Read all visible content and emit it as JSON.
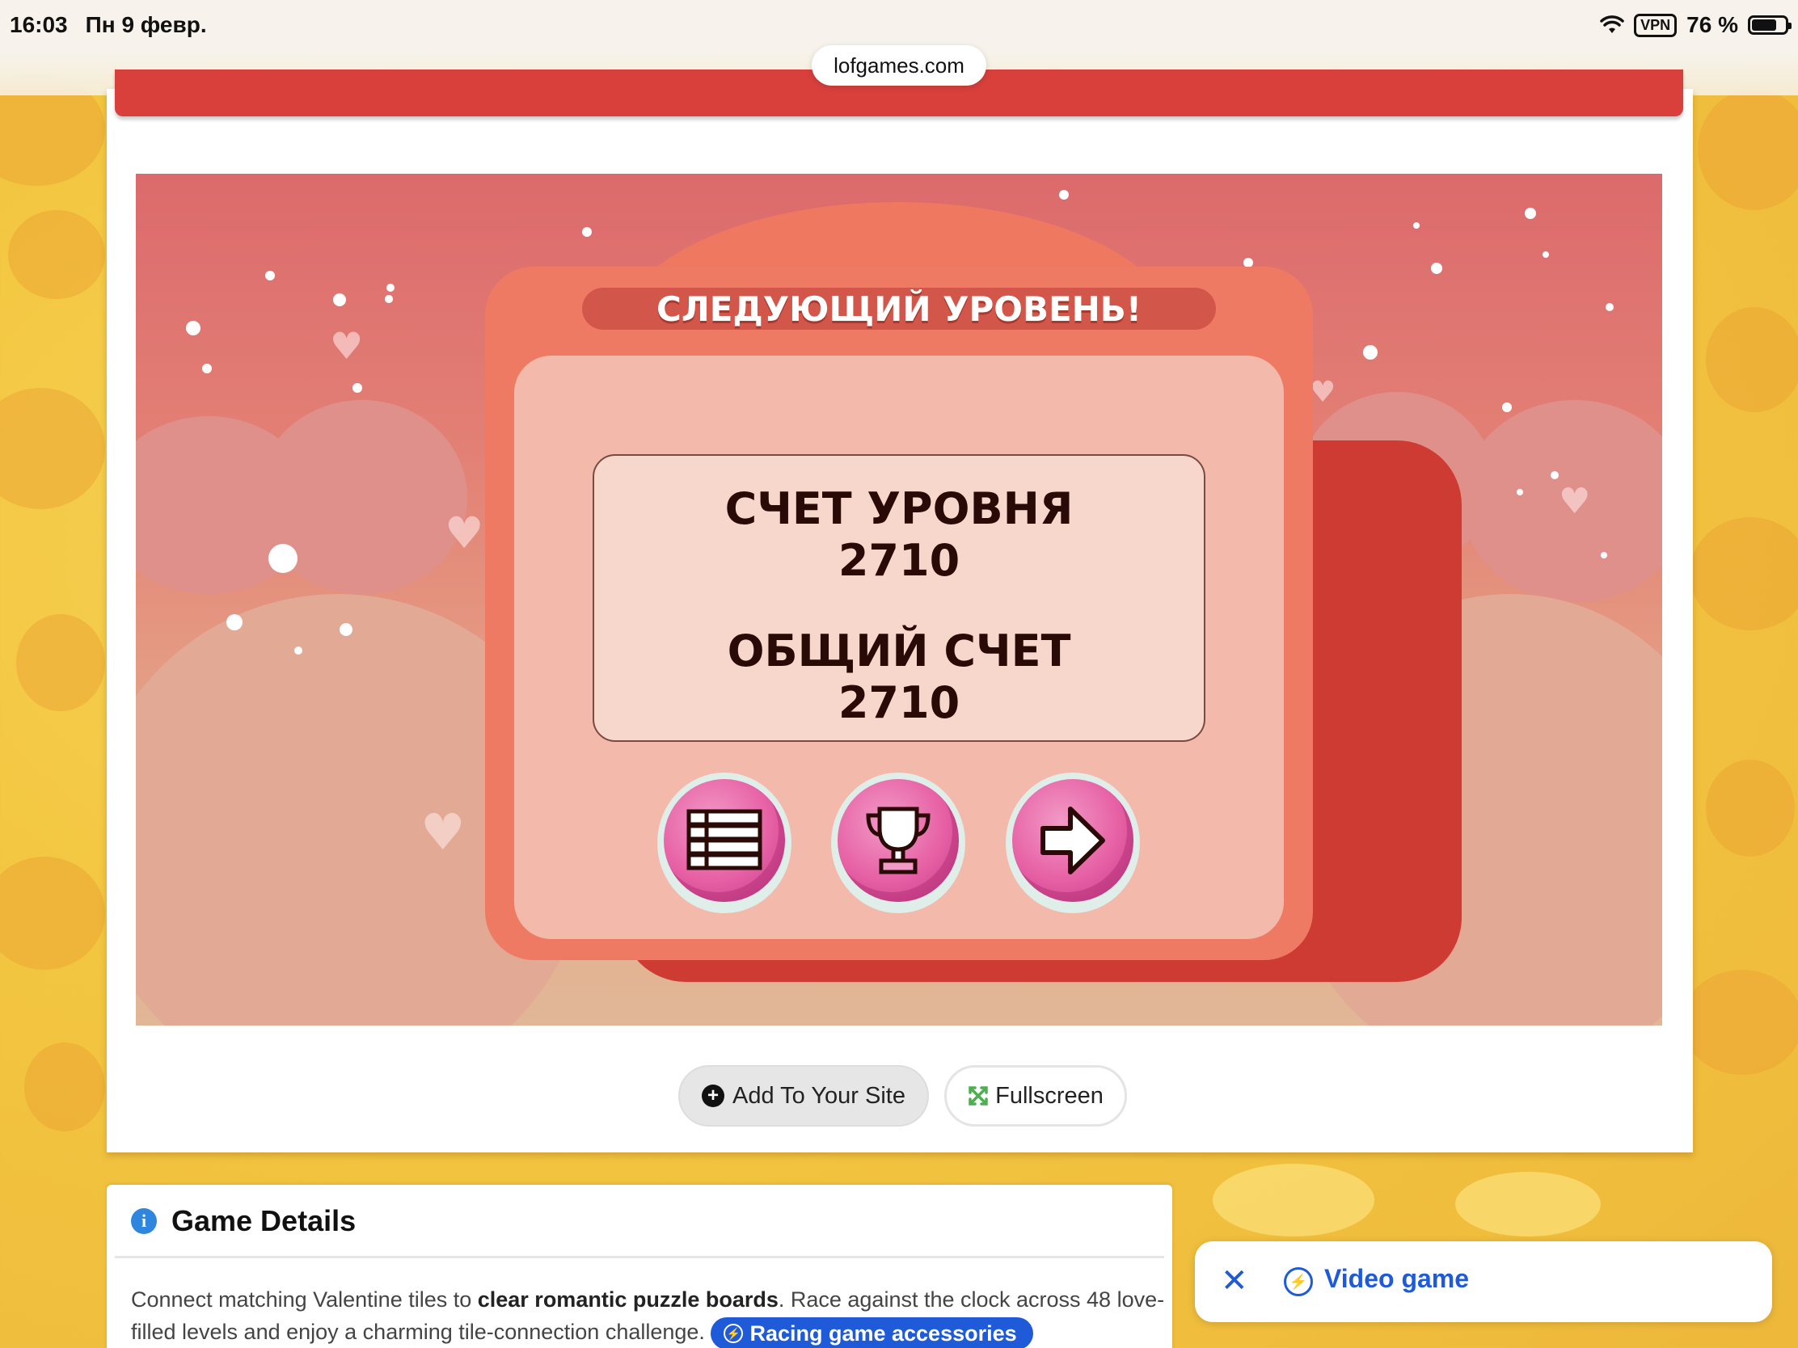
{
  "status_bar": {
    "time": "16:03",
    "date": "Пн 9 февр.",
    "vpn": "VPN",
    "battery": "76 %",
    "battery_level": 0.76
  },
  "browser": {
    "url": "lofgames.com"
  },
  "game": {
    "dialog_title": "СЛЕДУЮЩИЙ УРОВЕНЬ!",
    "level_score_label": "СЧЕТ УРОВНЯ",
    "level_score_value": "2710",
    "total_score_label": "ОБЩИЙ СЧЕТ",
    "total_score_value": "2710",
    "buttons": [
      {
        "icon": "menu-list-icon"
      },
      {
        "icon": "trophy-icon"
      },
      {
        "icon": "arrow-right-icon"
      }
    ]
  },
  "controls": {
    "add_to_site": "Add To Your Site",
    "fullscreen": "Fullscreen"
  },
  "details": {
    "title": "Game Details",
    "text_part1": "Connect matching Valentine tiles to ",
    "text_bold": "clear romantic puzzle boards",
    "text_part2": ". Race against the clock across 48 love-filled levels and enjoy a charming tile-connection challenge.",
    "chip_label": "Racing game accessories"
  },
  "video_popup": {
    "label": "Video game"
  },
  "colors": {
    "accent_blue": "#1f5bd8",
    "header_red": "#d9403c",
    "dialog_orange": "#ef7a63",
    "game_button_pink": "#e65fa4"
  }
}
